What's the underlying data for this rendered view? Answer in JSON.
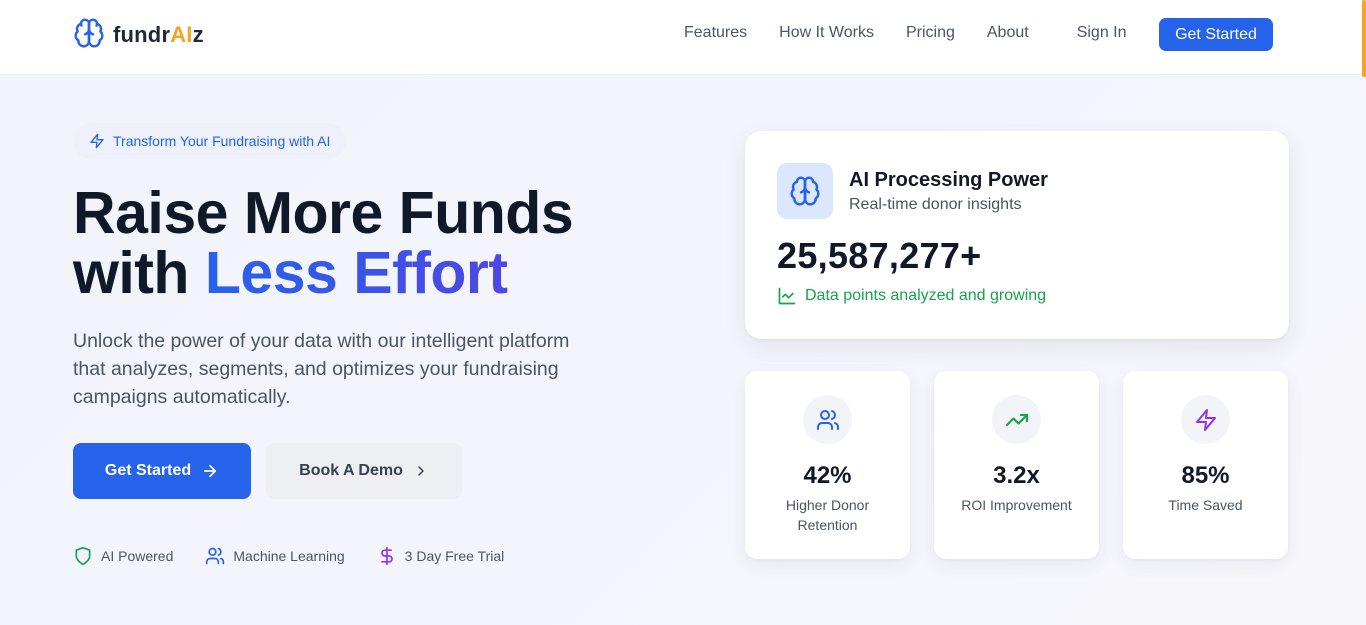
{
  "brand": {
    "name_prefix": "fundr",
    "name_ai": "AI",
    "name_suffix": "z",
    "logo_icon": "brain-icon",
    "accent_color": "#f5a524",
    "primary_color": "#2563eb"
  },
  "nav": {
    "items": [
      {
        "label": "Features"
      },
      {
        "label": "How It Works"
      },
      {
        "label": "Pricing"
      },
      {
        "label": "About"
      }
    ],
    "sign_in": "Sign In",
    "cta": "Get Started"
  },
  "hero": {
    "badge": "Transform Your Fundraising with AI",
    "badge_icon": "bolt-icon",
    "headline_line1": "Raise More Funds",
    "headline_line2_prefix": "with ",
    "headline_line2_accent": "Less Effort",
    "subheadline": "Unlock the power of your data with our intelligent platform that analyzes, segments, and optimizes your fundraising campaigns automatically.",
    "primary_button": "Get Started",
    "secondary_button": "Book A Demo",
    "features": [
      {
        "label": "AI Powered",
        "icon": "shield-icon",
        "color": "#16a34a"
      },
      {
        "label": "Machine Learning",
        "icon": "users-icon",
        "color": "#2563eb"
      },
      {
        "label": "3 Day Free Trial",
        "icon": "dollar-icon",
        "color": "#9333ea"
      }
    ]
  },
  "processing_card": {
    "title": "AI Processing Power",
    "subtitle": "Real-time donor insights",
    "value": "25,587,277+",
    "note": "Data points analyzed and growing",
    "icon": "brain-icon",
    "note_color": "#16a34a"
  },
  "stats": [
    {
      "value": "42%",
      "label": "Higher Donor Retention",
      "icon": "users-icon",
      "color": "#2563eb"
    },
    {
      "value": "3.2x",
      "label": "ROI Improvement",
      "icon": "trending-up-icon",
      "color": "#16a34a"
    },
    {
      "value": "85%",
      "label": "Time Saved",
      "icon": "bolt-icon",
      "color": "#9333ea"
    }
  ]
}
